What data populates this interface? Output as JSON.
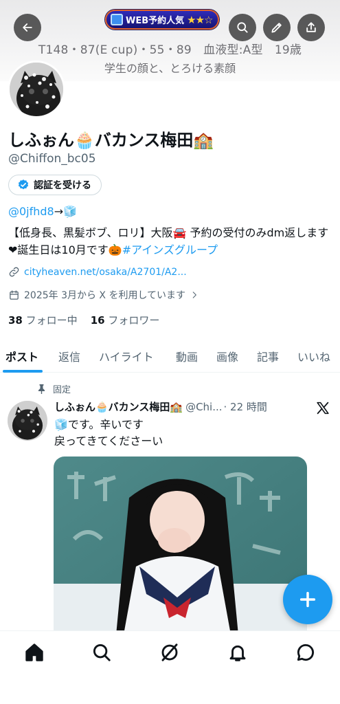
{
  "banner": {
    "stats_line": "T148・87(E cup)・55・89　血液型:A型　19歳",
    "tagline": "学生の顔と、とろける素顔",
    "badge_text": "WEB予約人気",
    "badge_stars": "★★☆"
  },
  "header": {
    "back_icon": "back-arrow-icon",
    "search_icon": "search-icon",
    "edit_icon": "pencil-icon",
    "share_icon": "share-icon"
  },
  "profile": {
    "name": "しふぉん🧁バカンス梅田🏫",
    "handle": "@Chiffon_bc05",
    "verify_button": "認証を受ける",
    "bio_mention": "@0jfhd8",
    "bio_arrow": "→",
    "bio_emoji": "🧊",
    "bio_text": "【低身長、黒髪ボブ、ロリ】大阪🚘 予約の受付のみdm返します❤誕生日は10月です🎃",
    "bio_hashtag": "#アインズグループ",
    "link": "cityheaven.net/osaka/A2701/A2...",
    "joined": "2025年 3月から X を利用しています",
    "following_count": "38",
    "following_label": "フォロー中",
    "followers_count": "16",
    "followers_label": "フォロワー"
  },
  "tabs": [
    {
      "label": "ポスト",
      "active": true
    },
    {
      "label": "返信"
    },
    {
      "label": "ハイライト"
    },
    {
      "label": "動画"
    },
    {
      "label": "画像"
    },
    {
      "label": "記事"
    },
    {
      "label": "いいね"
    }
  ],
  "post": {
    "pinned_label": "固定",
    "name": "しふぉん🧁バカンス梅田🏫",
    "handle": "@Chi...",
    "time": "· 22 時間",
    "line1": "🧊です。辛いです",
    "line2": "戻ってきてくださーい"
  },
  "bottom_nav": [
    "home-icon",
    "search-icon",
    "grok-icon",
    "notifications-icon",
    "messages-icon"
  ],
  "colors": {
    "accent": "#1d9bf0",
    "text": "#0f1419",
    "secondary": "#536471"
  }
}
